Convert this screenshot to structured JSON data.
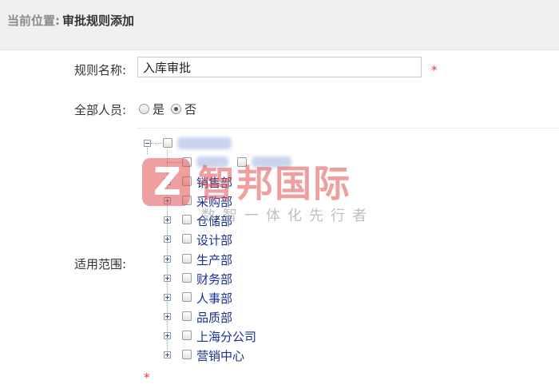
{
  "breadcrumb": {
    "prefix": "当前位置:",
    "current": "审批规则添加"
  },
  "form": {
    "rule_name_label": "规则名称:",
    "rule_name_value": "入库审批",
    "required_mark": "*",
    "all_personnel_label": "全部人员:",
    "radio_yes": "是",
    "radio_no": "否",
    "radio_selected": "否",
    "scope_label": "适用范围:"
  },
  "tree": {
    "departments": [
      "销售部",
      "采购部",
      "仓储部",
      "设计部",
      "生产部",
      "财务部",
      "人事部",
      "品质部",
      "上海分公司",
      "营销中心"
    ]
  },
  "watermark": {
    "logo_letter": "Z",
    "title": "智邦国际",
    "subtitle": "数智一体化先行者"
  }
}
